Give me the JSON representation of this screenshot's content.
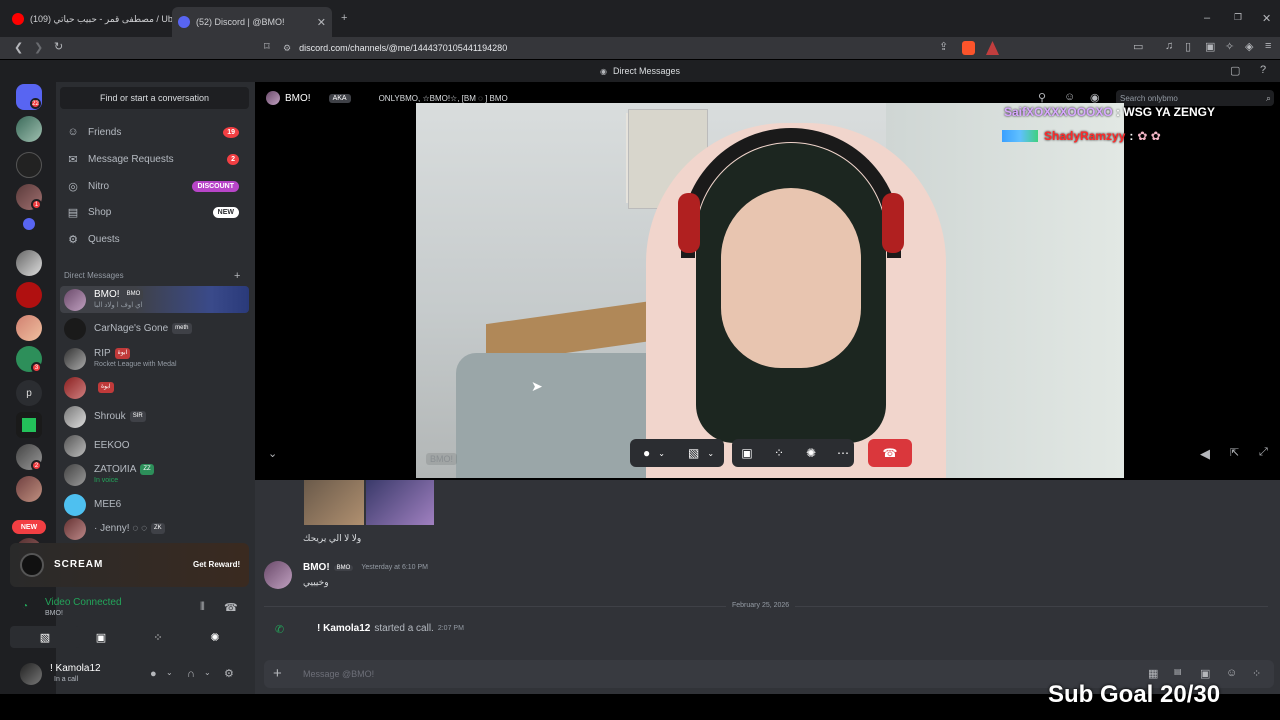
{
  "browser": {
    "tab1_title": "(109) مصطفى قمر - حبيب حياتي / Ube",
    "tab2_title": "(52) Discord | @BMO!",
    "url": "discord.com/channels/@me/1444370105441194280"
  },
  "discord": {
    "top_title": "Direct Messages",
    "server_badges": [
      "22",
      "1",
      "2",
      "3"
    ],
    "new_label": "NEW",
    "find_conversation": "Find or start a conversation",
    "nav": [
      {
        "label": "Friends",
        "badge": "19",
        "icon": "friends-icon"
      },
      {
        "label": "Message Requests",
        "badge": "2",
        "icon": "mail-icon"
      },
      {
        "label": "Nitro",
        "badge": "DISCOUNT",
        "icon": "nitro-icon"
      },
      {
        "label": "Shop",
        "badge": "NEW",
        "icon": "shop-icon"
      },
      {
        "label": "Quests",
        "badge": "",
        "icon": "quests-icon"
      }
    ],
    "dm_header": "Direct Messages",
    "dms": [
      {
        "name": "BMO!",
        "tag": "BMO",
        "sub": "اي اوف ا ولاد البا"
      },
      {
        "name": "CarNage's Gone",
        "tag": "meth",
        "sub": ""
      },
      {
        "name": "RIP",
        "tag": "ابوة",
        "sub": "Rocket League with Medal"
      },
      {
        "name": "",
        "tag": "ابوة",
        "sub": ""
      },
      {
        "name": "Shrouk",
        "tag": "SIR",
        "sub": ""
      },
      {
        "name": "EEKOO",
        "tag": "",
        "sub": ""
      },
      {
        "name": "ZATOИIA",
        "tag": "ZZ",
        "sub": "In voice"
      },
      {
        "name": "MEE6",
        "tag": "",
        "sub": ""
      },
      {
        "name": "· Jenny! ◌ ◌",
        "tag": "ZK",
        "sub": ""
      }
    ],
    "promo": {
      "label": "SCREAM",
      "button": "Get Reward!"
    },
    "voice": {
      "status": "Video Connected",
      "channel": "BMO!"
    },
    "user": {
      "name": "! Kamola12",
      "status": "In a call"
    }
  },
  "call": {
    "user_name": "BMO!",
    "aka_label": "AKA",
    "aka_names": "ONLYBMO, ☆BMO!☆, [BM ◌ ] BMO",
    "search_placeholder": "Search onlybmo",
    "video_label": "BMO!",
    "overlay_chat": [
      {
        "user": "SaifXOXXXOOOXO",
        "text": ": WSG YA ZENGY"
      },
      {
        "user": "ShadyRamzyy",
        "text": ":"
      }
    ]
  },
  "chat": {
    "message1": "ولا لا الي يريحك",
    "message2_author": "BMO!",
    "message2_tag": "BMO",
    "message2_time": "Yesterday at 6:10 PM",
    "message2_text": "وخيييي",
    "date_divider": "February 25, 2026",
    "call_author": "! Kamola12",
    "call_text": "started a call.",
    "call_time": "2:07 PM",
    "input_placeholder": "Message @BMO!"
  },
  "stream": {
    "sub_goal": "Sub Goal 20/30"
  },
  "colors": {
    "blurple": "#5865f2",
    "red": "#f23f43",
    "green": "#23a55a"
  }
}
